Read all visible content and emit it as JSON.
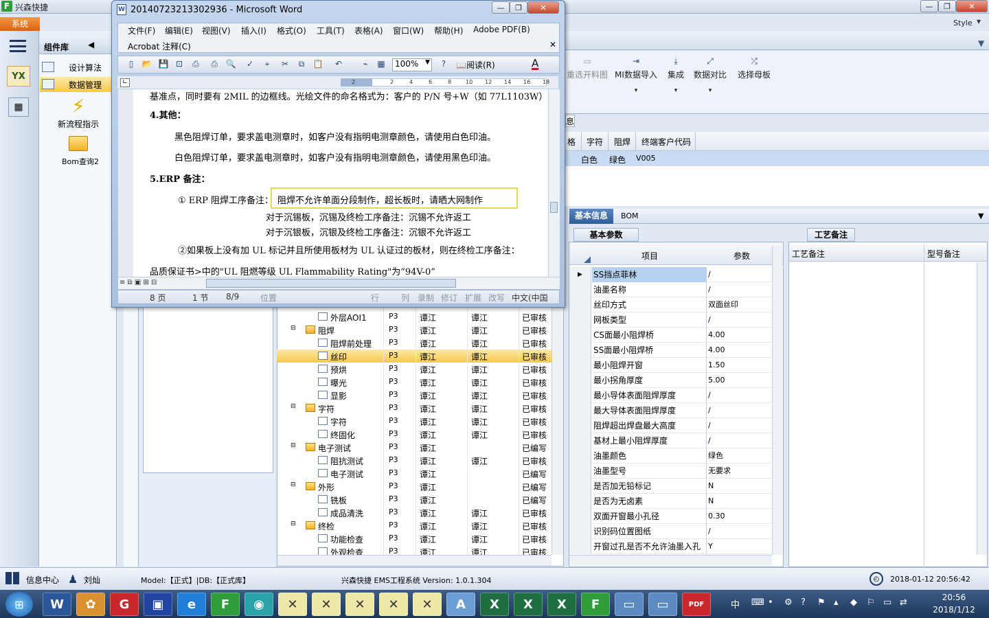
{
  "app": {
    "title": "兴森快捷",
    "system": "系统",
    "style": "Style"
  },
  "comp": {
    "header": "组件库",
    "items": [
      "设计算法",
      "数据管理"
    ],
    "icons": [
      "新流程指示",
      "Bom查询2"
    ]
  },
  "ribbon": {
    "buttons": [
      "重选开料图",
      "MI数据导入",
      "集成",
      "数据对比",
      "选择母板"
    ]
  },
  "tabs1": "息",
  "grid": {
    "headers": [
      "格",
      "字符",
      "阻焊",
      "终端客户代码"
    ],
    "row": [
      "白色",
      "绿色",
      "V005"
    ]
  },
  "bottomtabs": [
    "基本信息",
    "BOM"
  ],
  "params": {
    "tab": "基本参数",
    "col_item": "项目",
    "col_param": "参数",
    "rows": [
      [
        "SS挡点菲林",
        "/"
      ],
      [
        "油墨名称",
        "/"
      ],
      [
        "丝印方式",
        "双面丝印"
      ],
      [
        "网板类型",
        "/"
      ],
      [
        "CS面最小阻焊桥",
        "4.00"
      ],
      [
        "SS面最小阻焊桥",
        "4.00"
      ],
      [
        "最小阻焊开窗",
        "1.50"
      ],
      [
        "最小拐角厚度",
        "5.00"
      ],
      [
        "最小导体表面阻焊厚度",
        "/"
      ],
      [
        "最大导体表面阻焊厚度",
        "/"
      ],
      [
        "阻焊超出焊盘最大高度",
        "/"
      ],
      [
        "基材上最小阻焊厚度",
        "/"
      ],
      [
        "油墨颜色",
        "绿色"
      ],
      [
        "油墨型号",
        "无要求"
      ],
      [
        "是否加无铅标记",
        "N"
      ],
      [
        "是否为无卤素",
        "N"
      ],
      [
        "双面开窗最小孔径",
        "0.30"
      ],
      [
        "识别码位置图纸",
        "/"
      ],
      [
        "开窗过孔是否不允许油墨入孔",
        "Y"
      ]
    ]
  },
  "craft": {
    "tab": "工艺备注",
    "col1": "工艺备注",
    "col2": "型号备注"
  },
  "tree": [
    {
      "indent": 2,
      "folder": false,
      "name": "外层AOI1",
      "p": "P3",
      "a": "谭江",
      "b": "谭江",
      "s": "已审核"
    },
    {
      "indent": 1,
      "folder": true,
      "name": "阻焊",
      "p": "P3",
      "a": "谭江",
      "b": "谭江",
      "s": "已审核"
    },
    {
      "indent": 2,
      "folder": false,
      "name": "阻焊前处理",
      "p": "P3",
      "a": "谭江",
      "b": "谭江",
      "s": "已审核"
    },
    {
      "indent": 2,
      "folder": false,
      "name": "丝印",
      "p": "P3",
      "a": "谭江",
      "b": "谭江",
      "s": "已审核",
      "sel": true
    },
    {
      "indent": 2,
      "folder": false,
      "name": "预烘",
      "p": "P3",
      "a": "谭江",
      "b": "谭江",
      "s": "已审核"
    },
    {
      "indent": 2,
      "folder": false,
      "name": "曝光",
      "p": "P3",
      "a": "谭江",
      "b": "谭江",
      "s": "已审核"
    },
    {
      "indent": 2,
      "folder": false,
      "name": "显影",
      "p": "P3",
      "a": "谭江",
      "b": "谭江",
      "s": "已审核"
    },
    {
      "indent": 1,
      "folder": true,
      "name": "字符",
      "p": "P3",
      "a": "谭江",
      "b": "谭江",
      "s": "已审核"
    },
    {
      "indent": 2,
      "folder": false,
      "name": "字符",
      "p": "P3",
      "a": "谭江",
      "b": "谭江",
      "s": "已审核"
    },
    {
      "indent": 2,
      "folder": false,
      "name": "终固化",
      "p": "P3",
      "a": "谭江",
      "b": "谭江",
      "s": "已审核"
    },
    {
      "indent": 1,
      "folder": true,
      "name": "电子测试",
      "p": "P3",
      "a": "谭江",
      "b": "",
      "s": "已编写"
    },
    {
      "indent": 2,
      "folder": false,
      "name": "阻抗测试",
      "p": "P3",
      "a": "谭江",
      "b": "谭江",
      "s": "已审核"
    },
    {
      "indent": 2,
      "folder": false,
      "name": "电子测试",
      "p": "P3",
      "a": "谭江",
      "b": "",
      "s": "已编写"
    },
    {
      "indent": 1,
      "folder": true,
      "name": "外形",
      "p": "P3",
      "a": "谭江",
      "b": "",
      "s": "已编写"
    },
    {
      "indent": 2,
      "folder": false,
      "name": "铣板",
      "p": "P3",
      "a": "谭江",
      "b": "",
      "s": "已编写"
    },
    {
      "indent": 2,
      "folder": false,
      "name": "成品清洗",
      "p": "P3",
      "a": "谭江",
      "b": "谭江",
      "s": "已审核"
    },
    {
      "indent": 1,
      "folder": true,
      "name": "终检",
      "p": "P3",
      "a": "谭江",
      "b": "谭江",
      "s": "已审核"
    },
    {
      "indent": 2,
      "folder": false,
      "name": "功能检查",
      "p": "P3",
      "a": "谭江",
      "b": "谭江",
      "s": "已审核"
    },
    {
      "indent": 2,
      "folder": false,
      "name": "外观检查",
      "p": "P3",
      "a": "谭江",
      "b": "谭江",
      "s": "已审核"
    }
  ],
  "status": {
    "info": "信息中心",
    "user": "刘灿",
    "model": "Model:【正式】|DB:【正式库】",
    "version": "兴森快捷 EMS工程系统 Version: 1.0.1.304",
    "datetime": "2018-01-12 20:56:42"
  },
  "clock": {
    "time": "20:56",
    "date": "2018/1/12",
    "ime": "中"
  },
  "word": {
    "title": "20140723213302936 - Microsoft Word",
    "menu": [
      "文件(F)",
      "编辑(E)",
      "视图(V)",
      "插入(I)",
      "格式(O)",
      "工具(T)",
      "表格(A)",
      "窗口(W)",
      "帮助(H)",
      "Adobe PDF(B)"
    ],
    "menu2": "Acrobat 注释(C)",
    "zoom": "100%",
    "read": "阅读(R)",
    "ruler": [
      "2",
      "2",
      "4",
      "6",
      "8",
      "10",
      "12",
      "14",
      "16",
      "18"
    ],
    "lines": [
      "基准点，同时要有 2MIL 的边框线。光绘文件的命名格式为：客户的 P/N 号+W（如 77L1103W）;",
      "4.其他：",
      "黑色阻焊订单，要求盖电测章时，如客户没有指明电测章颜色，请使用白色印油。",
      "白色阻焊订单，要求盖电测章时，如客户没有指明电测章颜色，请使用黑色印油。",
      "5.ERP 备注：",
      "① ERP 阻焊工序备注：",
      "阻焊不允许单面分段制作，超长板时，请晒大网制作",
      "对于沉锡板，沉锡及终检工序备注：沉锡不允许返工",
      "对于沉银板，沉银及终检工序备注：沉银不允许返工",
      "②如果板上没有加 UL 标记并且所使用板材为 UL 认证过的板材，则在终检工序备注：",
      "品质保证书>中的\"UL 阻燃等级 UL Flammability Rating\"为“94V-0”"
    ],
    "status": [
      "8 页",
      "1 节",
      "8/9",
      "位置",
      "行",
      "列",
      "录制",
      "修订",
      "扩展",
      "改写",
      "中文(中国"
    ]
  }
}
